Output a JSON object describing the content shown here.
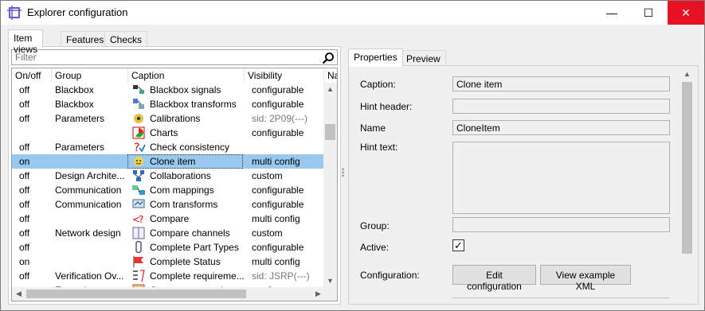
{
  "window": {
    "title": "Explorer configuration",
    "min": "—",
    "max": "☐",
    "close": "✕"
  },
  "left_tabs": [
    "Item views",
    "Features",
    "Checks"
  ],
  "filter": {
    "placeholder": "Filter",
    "value": ""
  },
  "columns": [
    "On/off",
    "Group",
    "Caption",
    "Visibility",
    "Na"
  ],
  "rows": [
    {
      "on": "off",
      "group": "Blackbox",
      "icon": "blackbox-signals-icon",
      "caption": "Blackbox signals",
      "visibility": "configurable",
      "grey": false
    },
    {
      "on": "off",
      "group": "Blackbox",
      "icon": "blackbox-transforms-icon",
      "caption": "Blackbox transforms",
      "visibility": "configurable",
      "grey": false
    },
    {
      "on": "off",
      "group": "Parameters",
      "icon": "calibrations-icon",
      "caption": "Calibrations",
      "visibility": "sid: 2P09(---)",
      "grey": true
    },
    {
      "on": "",
      "group": "",
      "icon": "charts-icon",
      "caption": "Charts",
      "visibility": "configurable",
      "grey": false
    },
    {
      "on": "off",
      "group": "Parameters",
      "icon": "check-consistency-icon",
      "caption": "Check consistency",
      "visibility": "",
      "grey": false
    },
    {
      "on": "on",
      "group": "",
      "icon": "clone-item-icon",
      "caption": "Clone item",
      "visibility": "multi config",
      "grey": false,
      "selected": true
    },
    {
      "on": "off",
      "group": "Design Archite...",
      "icon": "collaborations-icon",
      "caption": "Collaborations",
      "visibility": "custom",
      "grey": false
    },
    {
      "on": "off",
      "group": "Communication",
      "icon": "com-mappings-icon",
      "caption": "Com mappings",
      "visibility": "configurable",
      "grey": false
    },
    {
      "on": "off",
      "group": "Communication",
      "icon": "com-transforms-icon",
      "caption": "Com transforms",
      "visibility": "configurable",
      "grey": false
    },
    {
      "on": "off",
      "group": "",
      "icon": "compare-icon",
      "caption": "Compare",
      "visibility": "multi config",
      "grey": false
    },
    {
      "on": "off",
      "group": "Network design",
      "icon": "compare-channels-icon",
      "caption": "Compare channels",
      "visibility": "custom",
      "grey": false
    },
    {
      "on": "off",
      "group": "",
      "icon": "complete-part-types-icon",
      "caption": "Complete Part Types",
      "visibility": "configurable",
      "grey": false
    },
    {
      "on": "on",
      "group": "",
      "icon": "complete-status-icon",
      "caption": "Complete Status",
      "visibility": "multi config",
      "grey": false
    },
    {
      "on": "off",
      "group": "Verification Ov...",
      "icon": "complete-requirements-icon",
      "caption": "Complete requireme...",
      "visibility": "sid: JSRP(---)",
      "grey": true
    },
    {
      "on": "on",
      "group": "Extensions",
      "icon": "component-graph-icon",
      "caption": "Component graph",
      "visibility": "config error",
      "grey": false
    }
  ],
  "right_tabs": [
    "Properties",
    "Preview"
  ],
  "properties": {
    "caption_label": "Caption:",
    "caption_value": "Clone item",
    "hint_header_label": "Hint header:",
    "hint_header_value": "",
    "name_label": "Name",
    "name_value": "CloneItem",
    "hint_text_label": "Hint text:",
    "group_label": "Group:",
    "group_value": "",
    "active_label": "Active:",
    "active_checked": "✓",
    "configuration_label": "Configuration:",
    "edit_configuration": "Edit configuration",
    "view_example_xml": "View example XML"
  },
  "colors": {
    "selection": "#99c9ef",
    "close_button": "#e81123"
  }
}
